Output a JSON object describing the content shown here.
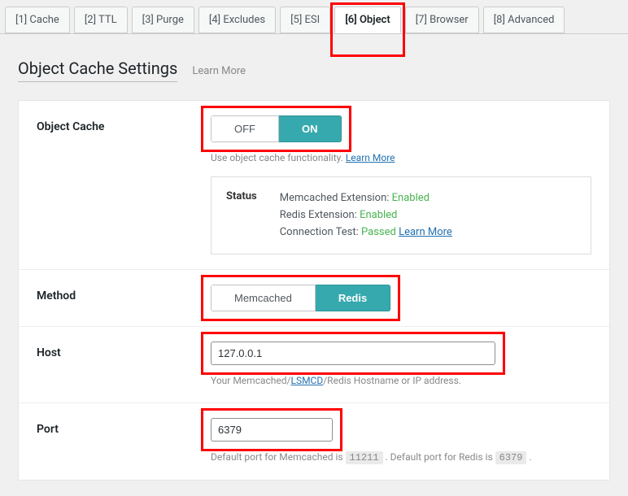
{
  "tabs": {
    "items": [
      {
        "label": "[1] Cache"
      },
      {
        "label": "[2] TTL"
      },
      {
        "label": "[3] Purge"
      },
      {
        "label": "[4] Excludes"
      },
      {
        "label": "[5] ESI"
      },
      {
        "label": "[6] Object"
      },
      {
        "label": "[7] Browser"
      },
      {
        "label": "[8] Advanced"
      }
    ],
    "active_index": 5
  },
  "header": {
    "title": "Object Cache Settings",
    "learn_more": "Learn More"
  },
  "object_cache": {
    "label": "Object Cache",
    "off": "OFF",
    "on": "ON",
    "active": "on",
    "desc_prefix": "Use object cache functionality. ",
    "desc_link": "Learn More"
  },
  "status": {
    "label": "Status",
    "memcached_label": "Memcached Extension: ",
    "memcached_value": "Enabled",
    "redis_label": "Redis Extension: ",
    "redis_value": "Enabled",
    "conn_label": "Connection Test: ",
    "conn_value": "Passed",
    "conn_link": "Learn More"
  },
  "method": {
    "label": "Method",
    "memcached": "Memcached",
    "redis": "Redis",
    "active": "redis"
  },
  "host": {
    "label": "Host",
    "value": "127.0.0.1",
    "desc_pre": "Your Memcached/",
    "desc_link": "LSMCD",
    "desc_post": "/Redis Hostname or IP address."
  },
  "port": {
    "label": "Port",
    "value": "6379",
    "desc_pre": "Default port for Memcached is ",
    "memcached_port": "11211",
    "desc_mid": " . Default port for Redis is ",
    "redis_port": "6379",
    "desc_post": " ."
  }
}
